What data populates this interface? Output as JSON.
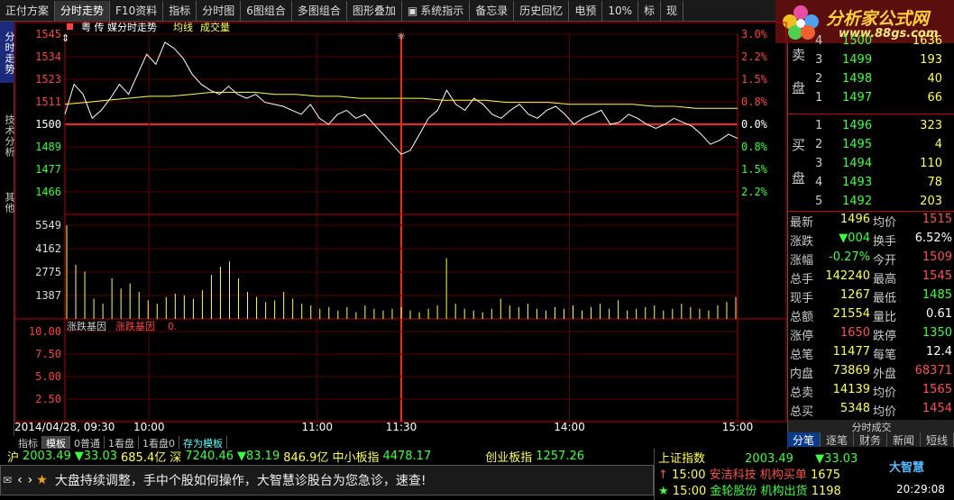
{
  "toolbar": {
    "items": [
      "正付方案",
      "分时走势",
      "F10资料",
      "指标",
      "分时图",
      "6图组合",
      "多图组合",
      "图形叠加",
      "系统指示",
      "备忘录",
      "历史回忆",
      "电预",
      "10%",
      "标",
      "现"
    ]
  },
  "brand": {
    "title": "分析家公式网",
    "url": "www.88gs.com"
  },
  "side_tabs": [
    "分时走势",
    "技术分析",
    "其他"
  ],
  "chart": {
    "stock_name": "粤 传 媒分时走势",
    "legend_avg": "均线",
    "legend_vol": "成交量",
    "price_ticks": [
      "1545",
      "1534",
      "1523",
      "1511",
      "1500",
      "1489",
      "1477",
      "1466"
    ],
    "pct_ticks": [
      "3.0%",
      "2.2%",
      "1.5%",
      "0.8%",
      "0.0%",
      "0.8%",
      "1.5%",
      "2.2%"
    ],
    "vol_ticks": [
      "5549",
      "4162",
      "2775",
      "1387"
    ],
    "ind_ticks": [
      "10.00",
      "7.50",
      "5.00",
      "2.50"
    ],
    "indicator_name": "涨跌基因",
    "indicator_name2": "涨跌基因",
    "indicator_val": "0.",
    "time_ticks": [
      "2014/04/28, 09:30",
      "10:00",
      "11:00",
      "11:30",
      "14:00",
      "15:00"
    ]
  },
  "chart_data": {
    "type": "line",
    "title": "粤 传 媒分时走势",
    "prev_close": 1500,
    "ylim": [
      1460,
      1550
    ],
    "price": [
      1510,
      1525,
      1520,
      1508,
      1512,
      1518,
      1525,
      1520,
      1530,
      1540,
      1535,
      1546,
      1543,
      1538,
      1530,
      1525,
      1522,
      1520,
      1524,
      1520,
      1518,
      1520,
      1516,
      1515,
      1514,
      1512,
      1510,
      1515,
      1508,
      1505,
      1510,
      1512,
      1508,
      1510,
      1505,
      1500,
      1495,
      1490,
      1492,
      1500,
      1508,
      1512,
      1522,
      1515,
      1512,
      1518,
      1515,
      1510,
      1508,
      1512,
      1515,
      1510,
      1508,
      1512,
      1514,
      1510,
      1505,
      1508,
      1510,
      1512,
      1505,
      1506,
      1510,
      1508,
      1505,
      1503,
      1505,
      1508,
      1506,
      1504,
      1500,
      1495,
      1497,
      1500,
      1498
    ],
    "avg": [
      1515,
      1516,
      1517,
      1518,
      1519,
      1519,
      1520,
      1521,
      1521,
      1521,
      1520,
      1520,
      1519,
      1519,
      1518,
      1518,
      1518,
      1518,
      1517,
      1517,
      1517,
      1516,
      1516,
      1516,
      1515,
      1515,
      1515,
      1515,
      1514,
      1514,
      1513,
      1513,
      1513
    ],
    "volume": [
      5549,
      3200,
      2800,
      1200,
      900,
      2400,
      1800,
      2100,
      1600,
      1100,
      900,
      1300,
      1500,
      1400,
      1200,
      1700,
      2600,
      3100,
      3400,
      2400,
      1600,
      1300,
      1000,
      1100,
      1600,
      1200,
      900,
      800,
      600,
      700,
      500,
      700,
      400,
      800,
      600,
      500,
      600,
      700,
      500,
      400,
      600,
      800,
      3600,
      900,
      600,
      500,
      400,
      600,
      1200,
      800,
      700,
      900,
      600,
      500,
      700,
      600,
      800,
      500,
      700,
      900,
      600,
      1100,
      500,
      600,
      700,
      800,
      500,
      600,
      900,
      700,
      600,
      500,
      800,
      1000,
      1300
    ]
  },
  "bottom_tabs": [
    "指标",
    "模板",
    "0普通",
    "1看盘",
    "1看盘0",
    "存为模板"
  ],
  "ticker": {
    "sh_label": "沪",
    "sh_val": "2003.49",
    "sh_chg": "▼33.03",
    "sh_amt": "685.4亿",
    "sz_label": "深",
    "sz_val": "7240.46",
    "sz_chg": "▼83.19",
    "sz_amt": "846.9亿",
    "zx_label": "中小板指",
    "zx_val": "4478.17",
    "cy_label": "创业板指",
    "cy_val": "1257.26"
  },
  "msg": "大盘持续调整，手中个股如何操作，大智慧诊股台为您急诊，速查!",
  "orders": {
    "sell": [
      [
        "4",
        "1500",
        "1636"
      ],
      [
        "3",
        "1499",
        "193"
      ],
      [
        "2",
        "1498",
        "40"
      ],
      [
        "1",
        "1497",
        "66"
      ]
    ],
    "buy": [
      [
        "1",
        "1496",
        "323"
      ],
      [
        "2",
        "1495",
        "4"
      ],
      [
        "3",
        "1494",
        "110"
      ],
      [
        "4",
        "1493",
        "78"
      ],
      [
        "5",
        "1492",
        "203"
      ]
    ],
    "sell_label": [
      "卖",
      "盘"
    ],
    "buy_label": [
      "买",
      "盘"
    ]
  },
  "quote": [
    [
      "最新",
      "1496",
      "均价",
      "1515"
    ],
    [
      "涨跌",
      "▼004",
      "换手",
      "6.52%"
    ],
    [
      "涨幅",
      "-0.27%",
      "今开",
      "1509"
    ],
    [
      "总手",
      "142240",
      "最高",
      "1545"
    ],
    [
      "现手",
      "1267",
      "最低",
      "1485"
    ],
    [
      "总额",
      "21554",
      "量比",
      "0.61"
    ],
    [
      "涨停",
      "1650",
      "跌停",
      "1350"
    ],
    [
      "总笔",
      "11477",
      "每笔",
      "12.4"
    ],
    [
      "内盘",
      "73869",
      "外盘",
      "68371"
    ],
    [
      "总卖",
      "14139",
      "均价",
      "1565"
    ],
    [
      "总买",
      "5348",
      "均价",
      "1454"
    ]
  ],
  "rpanel_footer": "分时成交",
  "rtabs": [
    "分笔",
    "逐笔",
    "财务",
    "新闻",
    "短线"
  ],
  "rnews": {
    "index_label": "上证指数",
    "index_val": "2003.49",
    "index_chg": "▼33.03",
    "n1_time": "15:00",
    "n1_text": "安洁科技 机构买单",
    "n1_val": "1675",
    "n2_time": "15:00",
    "n2_text": "金轮股份 机构出货",
    "n2_val": "1198",
    "clock": "20:29:08",
    "logo": "大智慧"
  }
}
